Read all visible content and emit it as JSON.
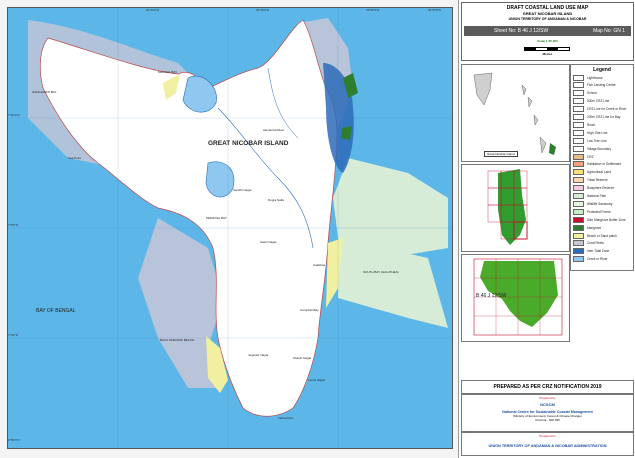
{
  "map": {
    "island_label": "GREAT NICOBAR ISLAND",
    "bay_label": "BAY OF BENGAL",
    "place_labels": [
      "GANGAWATI BAY",
      "MAGNAL BAY",
      "PEMAYAH BAY",
      "SOUTH BAY (GALATHEA)",
      "Alexandra River",
      "Galathea",
      "Dogra Nalla",
      "Indira Point",
      "Campbell Bay",
      "BACK PARAGWI BEACH",
      "Joginder Nagar",
      "Shastri Nagar",
      "Laxmi Nagar",
      "Gandhi Nagar",
      "Sea Point",
      "Sastri Nagar"
    ],
    "ticks_top": [
      "93°40'0\"E",
      "93°45'0\"E",
      "93°50'0\"E",
      "93°55'0\"E"
    ],
    "ticks_left": [
      "7°10'0\"N",
      "7°5'0\"N",
      "7°0'0\"N",
      "6°55'0\"N"
    ],
    "colors": {
      "sea": "#5cb6e8",
      "land": "#ffffff",
      "mangrove": "#2e6bb8",
      "ctz": "#d6ecd6",
      "beach": "#f0f0a0",
      "grey": "#c7c7d6"
    }
  },
  "panel": {
    "title": "DRAFT COASTAL LAND USE MAP",
    "subtitle1": "GREAT NICOBAR ISLAND",
    "subtitle2": "UNION TERRITORY OF ANDAMAN & NICOBAR",
    "sheet_no": "Sheet No: B 46 J 12/SW",
    "map_no": "Map No: GN 1",
    "scale_label": "Scale 1:25,000",
    "metres": "Metres",
    "legend_title": "Legend",
    "legend_items": [
      {
        "label": "Lighthouse",
        "color": "#ffffff"
      },
      {
        "label": "Fish Landing Centre",
        "color": "#ffffff"
      },
      {
        "label": "School",
        "color": "#ffffff"
      },
      {
        "label": "500m CRZ Line",
        "color": "#ffffff"
      },
      {
        "label": "CRZ Line for Creek or River",
        "color": "#ffffff"
      },
      {
        "label": "200m CRZ Line for Bay",
        "color": "#ffffff"
      },
      {
        "label": "Road",
        "color": "#ffffff"
      },
      {
        "label": "High Tide Line",
        "color": "#ffffff"
      },
      {
        "label": "Low Tide Line",
        "color": "#ffffff"
      },
      {
        "label": "Village Boundary",
        "color": "#ffffff"
      },
      {
        "label": "CRZ",
        "color": "#e6b890"
      },
      {
        "label": "Habitation or Settlement",
        "color": "#f2a07a"
      },
      {
        "label": "Agricultural Land",
        "color": "#f6e07a"
      },
      {
        "label": "Tribal Reserve",
        "color": "#f7d8b0"
      },
      {
        "label": "Biosphere Reserve",
        "color": "#f4cbe0"
      },
      {
        "label": "National Park",
        "color": "#d6ecd6"
      },
      {
        "label": "Wildlife Sanctuary",
        "color": "#e8f6e0"
      },
      {
        "label": "Protected Forest",
        "color": "#c8f0c8"
      },
      {
        "label": "50m Mangrove Buffer Zone",
        "color": "#c8102e"
      },
      {
        "label": "Mangrove",
        "color": "#2f7d2f"
      },
      {
        "label": "Beach or Sand patch",
        "color": "#f0f0a0"
      },
      {
        "label": "Coral Reefs",
        "color": "#c7c7d6"
      },
      {
        "label": "Inter Tidal Zone",
        "color": "#2e6bb8"
      },
      {
        "label": "Creek or River",
        "color": "#8ec8f0"
      }
    ],
    "inset_label": "Great Nicobar Island",
    "index_label": "B 46 J 12/SW",
    "notification": "PREPARED AS PER CRZ NOTIFICATION 2019",
    "prepared_by": "Prepared by",
    "ncscm_logo": "NCSCM",
    "org_name": "National Centre for Sustainable Coastal Management",
    "org_sub": "(Ministry of Environment, Forest & Climate Change)",
    "org_place": "Chennai - 600 025",
    "prepared_for": "Prepared for",
    "admin": "UNION TERRITORY OF ANDAMAN & NICOBAR ADMINISTRATION"
  }
}
